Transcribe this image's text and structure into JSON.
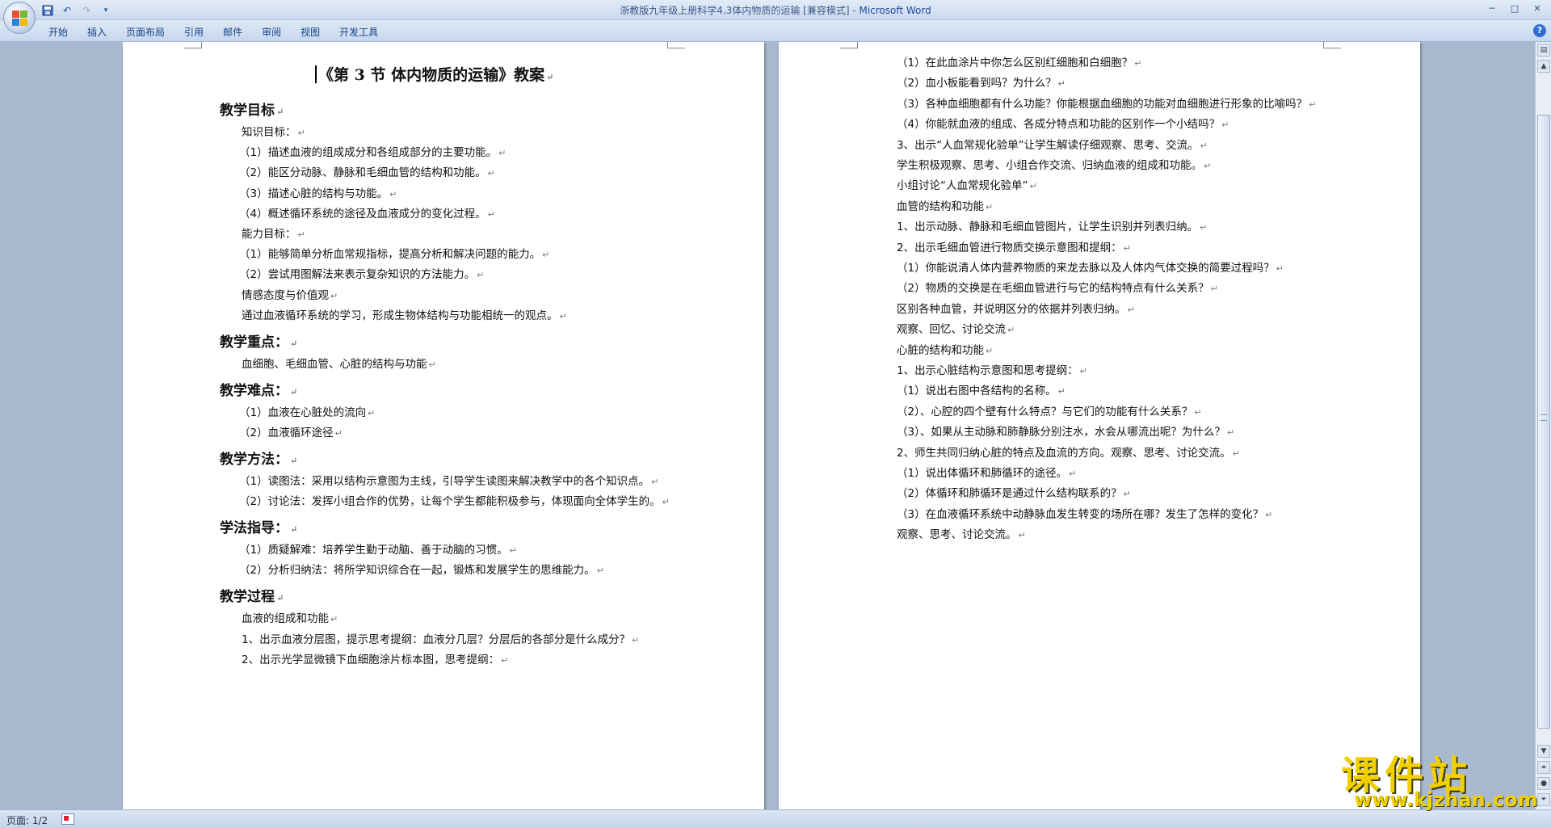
{
  "window": {
    "title": "浙教版九年级上册科学4.3体内物质的运输 [兼容模式] - ",
    "app_name": "Microsoft Word"
  },
  "ribbon": {
    "tabs": [
      "开始",
      "插入",
      "页面布局",
      "引用",
      "邮件",
      "审阅",
      "视图",
      "开发工具"
    ]
  },
  "status": {
    "page_indicator": "页面: 1/2"
  },
  "watermark": {
    "title": "课件站",
    "url": "www.kjzhan.com"
  },
  "page1": {
    "title": "《第 3 节  体内物质的运输》教案",
    "lines": [
      {
        "kind": "heading",
        "text": "教学目标"
      },
      {
        "kind": "text",
        "text": "知识目标："
      },
      {
        "kind": "text",
        "text": "（1）描述血液的组成成分和各组成部分的主要功能。"
      },
      {
        "kind": "text",
        "text": "（2）能区分动脉、静脉和毛细血管的结构和功能。"
      },
      {
        "kind": "text",
        "text": "（3）描述心脏的结构与功能。"
      },
      {
        "kind": "text",
        "text": "（4）概述循环系统的途径及血液成分的变化过程。"
      },
      {
        "kind": "text",
        "text": "能力目标："
      },
      {
        "kind": "text",
        "text": "（1）能够简单分析血常规指标，提高分析和解决问题的能力。"
      },
      {
        "kind": "text",
        "text": "（2）尝试用图解法来表示复杂知识的方法能力。"
      },
      {
        "kind": "text",
        "text": "情感态度与价值观"
      },
      {
        "kind": "text",
        "text": "通过血液循环系统的学习，形成生物体结构与功能相统一的观点。"
      },
      {
        "kind": "heading",
        "text": "教学重点："
      },
      {
        "kind": "text",
        "text": "血细胞、毛细血管、心脏的结构与功能"
      },
      {
        "kind": "heading",
        "text": "教学难点："
      },
      {
        "kind": "text",
        "text": "（1）血液在心脏处的流向"
      },
      {
        "kind": "text",
        "text": "（2）血液循环途径"
      },
      {
        "kind": "heading",
        "text": "教学方法："
      },
      {
        "kind": "text",
        "text": "（1）读图法：采用以结构示意图为主线，引导学生读图来解决教学中的各个知识点。"
      },
      {
        "kind": "text",
        "text": "（2）讨论法：发挥小组合作的优势，让每个学生都能积极参与，体现面向全体学生的。"
      },
      {
        "kind": "heading",
        "text": "学法指导："
      },
      {
        "kind": "text",
        "text": "（1）质疑解难：培养学生勤于动脑、善于动脑的习惯。"
      },
      {
        "kind": "text",
        "text": "（2）分析归纳法：将所学知识综合在一起，锻炼和发展学生的思维能力。"
      },
      {
        "kind": "heading",
        "text": "教学过程"
      },
      {
        "kind": "text",
        "text": "血液的组成和功能"
      },
      {
        "kind": "text",
        "text": "1、出示血液分层图，提示思考提纲：血液分几层？分层后的各部分是什么成分？"
      },
      {
        "kind": "text",
        "text": "2、出示光学显微镜下血细胞涂片标本图，思考提纲："
      }
    ]
  },
  "page2": {
    "lines": [
      "（1）在此血涂片中你怎么区别红细胞和白细胞？",
      "（2）血小板能看到吗？为什么？",
      "（3）各种血细胞都有什么功能？你能根据血细胞的功能对血细胞进行形象的比喻吗？",
      "（4）你能就血液的组成、各成分特点和功能的区别作一个小结吗？",
      "3、出示“人血常规化验单”让学生解读仔细观察、思考、交流。",
      "学生积极观察、思考、小组合作交流、归纳血液的组成和功能。",
      "小组讨论“人血常规化验单”",
      "血管的结构和功能",
      "1、出示动脉、静脉和毛细血管图片，让学生识别并列表归纳。",
      "2、出示毛细血管进行物质交换示意图和提纲：",
      "（1）你能说清人体内营养物质的来龙去脉以及人体内气体交换的简要过程吗？",
      "（2）物质的交换是在毛细血管进行与它的结构特点有什么关系？",
      "区别各种血管，并说明区分的依据并列表归纳。",
      "观察、回忆、讨论交流",
      "心脏的结构和功能",
      "1、出示心脏结构示意图和思考提纲：",
      "（1）说出右图中各结构的名称。",
      "（2）、心腔的四个壁有什么特点？与它们的功能有什么关系？",
      "（3）、如果从主动脉和肺静脉分别注水，水会从哪流出呢？为什么？",
      "2、师生共同归纳心脏的特点及血流的方向。观察、思考、讨论交流。",
      "（1）说出体循环和肺循环的途径。",
      "（2）体循环和肺循环是通过什么结构联系的？",
      "（3）在血液循环系统中动静脉血发生转变的场所在哪？发生了怎样的变化？",
      "观察、思考、讨论交流。"
    ]
  }
}
